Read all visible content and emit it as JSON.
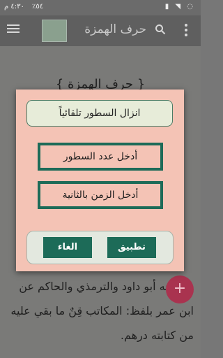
{
  "statusbar": {
    "time": "٤:٣٠ م",
    "battery": "٪٥٤",
    "icons": "▮ ◥ ◌"
  },
  "appbar": {
    "title": "حرف الهمزة"
  },
  "content": {
    "heading": "{ حرف الهمزة }",
    "body": "وأخرجه أبو داود والترمذي والحاكم عن ابن عمر بلفظ: المكاتب قِنٌ ما بقي عليه من كتابته درهم."
  },
  "dialog": {
    "title": "انزال السطور تلقائياً",
    "lines_field": "أدخل عدد السطور",
    "seconds_field": "أدخل الزمن بالثانية",
    "apply": "تطبيق",
    "cancel": "الغاء"
  },
  "fab": {
    "label": "+"
  }
}
